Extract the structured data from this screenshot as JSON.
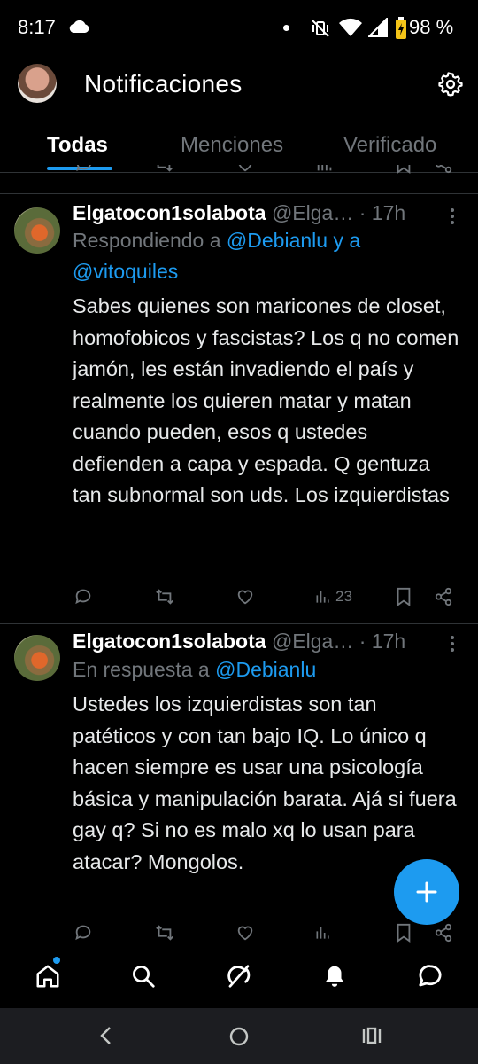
{
  "status_bar": {
    "time": "8:17",
    "battery_pct": "98 %"
  },
  "header": {
    "title": "Notificaciones"
  },
  "tabs": [
    {
      "label": "Todas",
      "active": true
    },
    {
      "label": "Menciones",
      "active": false
    },
    {
      "label": "Verificado",
      "active": false
    }
  ],
  "tweets": [
    {
      "name": "Elgatocon1solabota",
      "handle": "@Elga…",
      "separator": " · ",
      "time": "17h",
      "reply_prefix": "Respondiendo a ",
      "reply_mentions": "@Debianlu y a @vitoquiles",
      "body": "Sabes quienes son maricones de closet, homofobicos y fascistas? Los q no comen jamón, les están invadiendo el país y realmente los quieren matar y matan cuando pueden, esos q ustedes defienden a capa y espada. Q gentuza tan subnormal son uds. Los izquierdistas",
      "views": "23"
    },
    {
      "name": "Elgatocon1solabota",
      "handle": "@Elga…",
      "separator": " · ",
      "time": "17h",
      "reply_prefix": "En respuesta a ",
      "reply_mentions": "@Debianlu",
      "body": "Ustedes los izquierdistas son tan patéticos y con tan bajo IQ. Lo único q hacen siempre es usar una psicología básica y manipulación barata. Ajá si fuera gay q? Si no es malo xq lo usan para atacar? Mongolos.",
      "views": ""
    }
  ],
  "colors": {
    "accent": "#1d9bf0",
    "muted": "#71767b",
    "divider": "#2f3336"
  }
}
